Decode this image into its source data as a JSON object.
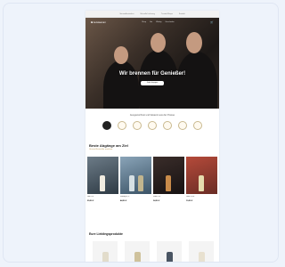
{
  "page": {
    "hero_title": "Wir brennen für Genießer!",
    "hero_button": "Jetzt shoppen",
    "press_title": "Ausgezeichnet und bekannt aus der Presse",
    "section_best_title": "Beste Abgänge am Ziel",
    "section_best_sub": "Unsere Bestseller ansehen",
    "section_favs_title": "Eure Lieblingsprodukte",
    "top_links": [
      "Versandkostenfrei",
      "Schnelle Lieferung",
      "Trusted Shops",
      "Kontakt"
    ],
    "nav_links": [
      "Shop",
      "Gin",
      "Whisky",
      "Geschenke"
    ],
    "brand": "Brennerei",
    "cart_symbol": "🛒",
    "products": [
      {
        "name": "Gin 0,5l",
        "price": "29,90 €"
      },
      {
        "name": "Whisky 0,7l",
        "price": "44,90 €"
      },
      {
        "name": "Rum 0,5l",
        "price": "34,90 €"
      },
      {
        "name": "Likör 0,35l",
        "price": "19,90 €"
      }
    ]
  }
}
